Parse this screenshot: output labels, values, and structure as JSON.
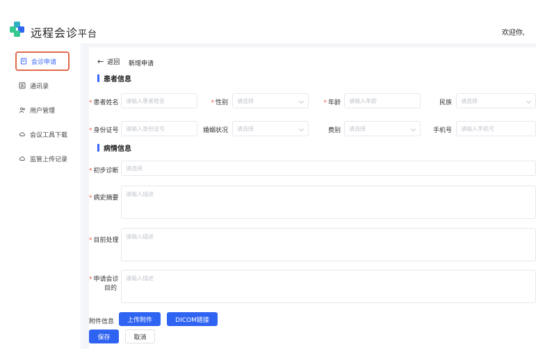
{
  "header": {
    "app_title": "远程会诊",
    "app_subtitle": "平台",
    "welcome": "欢迎你,",
    "logo_colors": [
      "#2fb0c5",
      "#36c98f",
      "#2f63f2"
    ]
  },
  "sidebar": {
    "items": [
      {
        "label": "会诊申请",
        "icon": "document-icon",
        "active": true
      },
      {
        "label": "通讯录",
        "icon": "contacts-icon",
        "active": false
      },
      {
        "label": "用户管理",
        "icon": "users-icon",
        "active": false
      },
      {
        "label": "会议工具下载",
        "icon": "cloud-download-icon",
        "active": false
      },
      {
        "label": "监管上传记录",
        "icon": "cloud-upload-icon",
        "active": false
      }
    ]
  },
  "topbar": {
    "back_label": "返回",
    "page_title": "新增申请"
  },
  "patient_section": {
    "title": "患者信息",
    "name": {
      "label": "患者姓名",
      "placeholder": "请输入患者姓名"
    },
    "gender": {
      "label": "性别",
      "placeholder": "请选择"
    },
    "age": {
      "label": "年龄",
      "placeholder": "请输入年龄"
    },
    "ethnicity": {
      "label": "民族",
      "placeholder": "请选择"
    },
    "id_number": {
      "label": "身份证号",
      "placeholder": "请输入身份证号"
    },
    "marital": {
      "label": "婚姻状况",
      "placeholder": "请选择"
    },
    "fee_type": {
      "label": "费别",
      "placeholder": "请选择"
    },
    "phone": {
      "label": "手机号",
      "placeholder": "请输入手机号"
    }
  },
  "condition_section": {
    "title": "病情信息",
    "diagnosis": {
      "label": "初步诊断",
      "placeholder": "请选择"
    },
    "history": {
      "label": "病史摘要",
      "placeholder": "请输入描述"
    },
    "treatment": {
      "label": "目前处理",
      "placeholder": "请输入描述"
    },
    "purpose": {
      "label_line1": "申请会诊",
      "label_line2": "目的",
      "placeholder": "请输入描述"
    }
  },
  "attachments": {
    "label": "附件信息",
    "upload_label": "上传附件",
    "dicom_label": "DICOM链接"
  },
  "actions": {
    "save_label": "保存",
    "cancel_label": "取消"
  },
  "colors": {
    "primary": "#2f63f2",
    "active_border": "#e06a4a",
    "required": "#e8553f"
  }
}
